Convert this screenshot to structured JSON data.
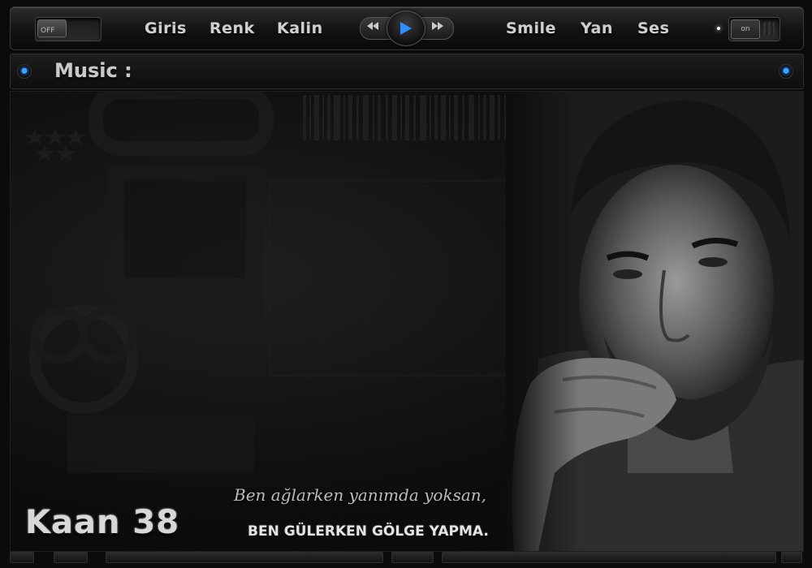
{
  "topbar": {
    "left_toggle": {
      "label": "OFF",
      "state": "off"
    },
    "nav_left": [
      "Giris",
      "Renk",
      "Kalin"
    ],
    "player": {
      "prev_icon": "rewind-icon",
      "play_icon": "play-icon",
      "next_icon": "fast-forward-icon"
    },
    "nav_right": [
      "Smile",
      "Yan",
      "Ses"
    ],
    "right_toggle": {
      "label": "on",
      "state": "on"
    }
  },
  "music_bar": {
    "label": "Music :"
  },
  "main": {
    "quote_line1": "Ben ağlarken yanımda yoksan,",
    "quote_line2": "BEN GÜLERKEN GÖLGE YAPMA.",
    "signature": "Kaan 38"
  },
  "colors": {
    "background": "#0b0b0c",
    "nav_text": "#cfcfcf",
    "accent_blue": "#3ea0ff",
    "play_triangle": "#2f8fff"
  }
}
